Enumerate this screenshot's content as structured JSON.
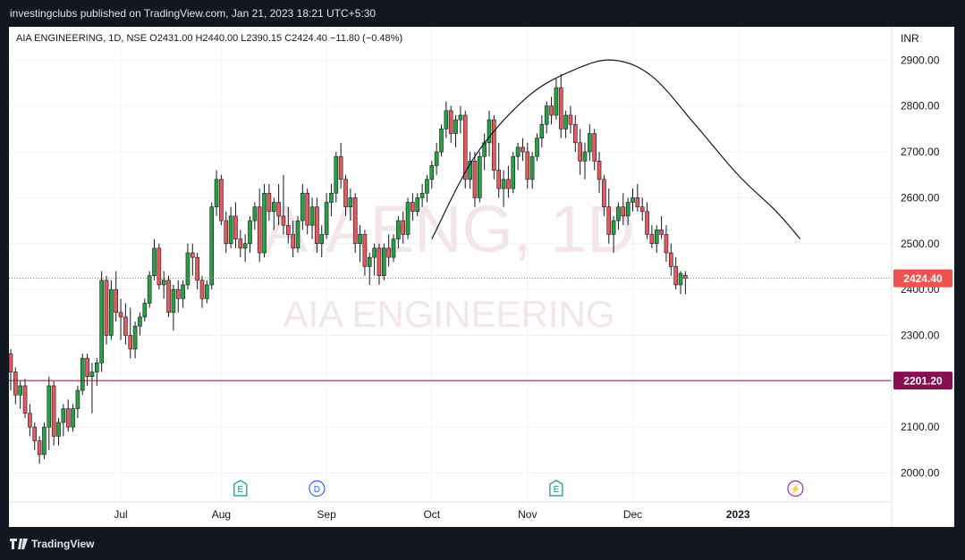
{
  "header": {
    "publish_text": "investingclubs published on TradingView.com, Jan 21, 2023 18:21 UTC+5:30"
  },
  "footer": {
    "brand": "TradingView"
  },
  "legend": {
    "text": "AIA ENGINEERING, 1D, NSE  O2431.00  H2440.00  L2390.15  C2424.40  −11.80  (−0.48%)"
  },
  "watermark": {
    "symbol": "AIAENG, 1D",
    "name": "AIA ENGINEERING"
  },
  "price_axis": {
    "currency": "INR"
  },
  "colors": {
    "up": "#26a240",
    "down": "#e8595b",
    "level_line": "#880e4f",
    "last_price_badge": "#ef5350",
    "curve": "#131722"
  },
  "chart_data": {
    "type": "candlestick",
    "ylim": [
      1950,
      2950
    ],
    "yticks": [
      2000,
      2100,
      2200,
      2300,
      2400,
      2500,
      2600,
      2700,
      2800,
      2900
    ],
    "ytick_labels": [
      "2000.00",
      "2100.00",
      "2200.00",
      "2300.00",
      "2400.00",
      "2500.00",
      "2600.00",
      "2700.00",
      "2800.00",
      "2900.00"
    ],
    "xticks": [
      {
        "label": "Jul",
        "bar": 23
      },
      {
        "label": "Aug",
        "bar": 44
      },
      {
        "label": "Sep",
        "bar": 66
      },
      {
        "label": "Oct",
        "bar": 88
      },
      {
        "label": "Nov",
        "bar": 108
      },
      {
        "label": "Dec",
        "bar": 130
      },
      {
        "label": "2023",
        "bar": 152
      }
    ],
    "last_price": {
      "value": 2424.4,
      "label": "2424.40"
    },
    "horizontal_level": {
      "value": 2201.2,
      "label": "2201.20"
    },
    "events": [
      {
        "bar": 48,
        "type": "earnings",
        "label": "E"
      },
      {
        "bar": 64,
        "type": "dividend",
        "label": "D"
      },
      {
        "bar": 114,
        "type": "earnings",
        "label": "E"
      },
      {
        "bar": 164,
        "type": "split",
        "label": "⚡"
      }
    ],
    "rounded_top_curve": [
      {
        "bar": 88,
        "price": 2510
      },
      {
        "bar": 97,
        "price": 2690
      },
      {
        "bar": 108,
        "price": 2820
      },
      {
        "bar": 118,
        "price": 2880
      },
      {
        "bar": 126,
        "price": 2900
      },
      {
        "bar": 134,
        "price": 2865
      },
      {
        "bar": 143,
        "price": 2760
      },
      {
        "bar": 152,
        "price": 2650
      },
      {
        "bar": 160,
        "price": 2570
      },
      {
        "bar": 165,
        "price": 2510
      }
    ],
    "candles": [
      [
        2260,
        2270,
        2180,
        2220
      ],
      [
        2220,
        2230,
        2150,
        2170
      ],
      [
        2170,
        2200,
        2140,
        2190
      ],
      [
        2190,
        2205,
        2120,
        2130
      ],
      [
        2130,
        2150,
        2080,
        2100
      ],
      [
        2100,
        2110,
        2050,
        2070
      ],
      [
        2070,
        2080,
        2020,
        2040
      ],
      [
        2040,
        2110,
        2030,
        2100
      ],
      [
        2100,
        2210,
        2050,
        2190
      ],
      [
        2190,
        2200,
        2060,
        2080
      ],
      [
        2080,
        2120,
        2060,
        2110
      ],
      [
        2110,
        2150,
        2080,
        2140
      ],
      [
        2140,
        2160,
        2090,
        2100
      ],
      [
        2100,
        2150,
        2090,
        2140
      ],
      [
        2140,
        2190,
        2120,
        2180
      ],
      [
        2180,
        2260,
        2170,
        2250
      ],
      [
        2250,
        2260,
        2190,
        2210
      ],
      [
        2210,
        2240,
        2130,
        2220
      ],
      [
        2220,
        2250,
        2190,
        2240
      ],
      [
        2240,
        2440,
        2220,
        2420
      ],
      [
        2420,
        2430,
        2280,
        2300
      ],
      [
        2300,
        2420,
        2290,
        2400
      ],
      [
        2400,
        2440,
        2330,
        2350
      ],
      [
        2350,
        2380,
        2290,
        2340
      ],
      [
        2340,
        2370,
        2280,
        2300
      ],
      [
        2300,
        2360,
        2250,
        2270
      ],
      [
        2270,
        2330,
        2250,
        2320
      ],
      [
        2320,
        2350,
        2300,
        2340
      ],
      [
        2340,
        2380,
        2330,
        2370
      ],
      [
        2370,
        2440,
        2360,
        2430
      ],
      [
        2430,
        2510,
        2420,
        2490
      ],
      [
        2490,
        2500,
        2400,
        2410
      ],
      [
        2410,
        2440,
        2380,
        2420
      ],
      [
        2420,
        2430,
        2340,
        2350
      ],
      [
        2350,
        2410,
        2310,
        2400
      ],
      [
        2400,
        2420,
        2350,
        2380
      ],
      [
        2380,
        2420,
        2360,
        2410
      ],
      [
        2410,
        2500,
        2400,
        2480
      ],
      [
        2480,
        2500,
        2430,
        2470
      ],
      [
        2470,
        2480,
        2400,
        2420
      ],
      [
        2420,
        2430,
        2360,
        2380
      ],
      [
        2380,
        2420,
        2370,
        2410
      ],
      [
        2410,
        2590,
        2400,
        2580
      ],
      [
        2580,
        2660,
        2560,
        2640
      ],
      [
        2640,
        2650,
        2540,
        2550
      ],
      [
        2550,
        2570,
        2480,
        2500
      ],
      [
        2500,
        2580,
        2490,
        2560
      ],
      [
        2560,
        2590,
        2490,
        2510
      ],
      [
        2510,
        2530,
        2470,
        2490
      ],
      [
        2490,
        2520,
        2460,
        2500
      ],
      [
        2500,
        2560,
        2480,
        2550
      ],
      [
        2550,
        2590,
        2530,
        2580
      ],
      [
        2580,
        2620,
        2460,
        2480
      ],
      [
        2480,
        2630,
        2470,
        2610
      ],
      [
        2610,
        2630,
        2550,
        2570
      ],
      [
        2570,
        2600,
        2530,
        2590
      ],
      [
        2590,
        2630,
        2540,
        2560
      ],
      [
        2560,
        2650,
        2520,
        2540
      ],
      [
        2540,
        2580,
        2500,
        2520
      ],
      [
        2520,
        2550,
        2470,
        2490
      ],
      [
        2490,
        2560,
        2480,
        2550
      ],
      [
        2550,
        2630,
        2530,
        2610
      ],
      [
        2610,
        2620,
        2520,
        2540
      ],
      [
        2540,
        2600,
        2510,
        2580
      ],
      [
        2580,
        2600,
        2480,
        2500
      ],
      [
        2500,
        2540,
        2470,
        2520
      ],
      [
        2520,
        2610,
        2510,
        2590
      ],
      [
        2590,
        2630,
        2560,
        2610
      ],
      [
        2610,
        2700,
        2590,
        2690
      ],
      [
        2690,
        2720,
        2620,
        2640
      ],
      [
        2640,
        2650,
        2560,
        2580
      ],
      [
        2580,
        2620,
        2550,
        2600
      ],
      [
        2600,
        2610,
        2480,
        2500
      ],
      [
        2500,
        2540,
        2460,
        2520
      ],
      [
        2520,
        2530,
        2430,
        2450
      ],
      [
        2450,
        2480,
        2410,
        2470
      ],
      [
        2470,
        2500,
        2430,
        2490
      ],
      [
        2490,
        2500,
        2410,
        2430
      ],
      [
        2430,
        2500,
        2420,
        2490
      ],
      [
        2490,
        2520,
        2450,
        2470
      ],
      [
        2470,
        2520,
        2460,
        2510
      ],
      [
        2510,
        2560,
        2490,
        2550
      ],
      [
        2550,
        2570,
        2500,
        2520
      ],
      [
        2520,
        2600,
        2510,
        2590
      ],
      [
        2590,
        2610,
        2550,
        2570
      ],
      [
        2570,
        2610,
        2560,
        2600
      ],
      [
        2600,
        2630,
        2580,
        2610
      ],
      [
        2610,
        2650,
        2590,
        2640
      ],
      [
        2640,
        2680,
        2620,
        2670
      ],
      [
        2670,
        2720,
        2650,
        2700
      ],
      [
        2700,
        2760,
        2690,
        2750
      ],
      [
        2750,
        2810,
        2730,
        2790
      ],
      [
        2790,
        2800,
        2720,
        2740
      ],
      [
        2740,
        2780,
        2710,
        2770
      ],
      [
        2770,
        2800,
        2740,
        2780
      ],
      [
        2780,
        2790,
        2620,
        2640
      ],
      [
        2640,
        2700,
        2620,
        2680
      ],
      [
        2680,
        2700,
        2580,
        2600
      ],
      [
        2600,
        2700,
        2590,
        2690
      ],
      [
        2690,
        2740,
        2660,
        2720
      ],
      [
        2720,
        2790,
        2690,
        2770
      ],
      [
        2770,
        2780,
        2640,
        2660
      ],
      [
        2660,
        2720,
        2600,
        2620
      ],
      [
        2620,
        2660,
        2580,
        2640
      ],
      [
        2640,
        2670,
        2600,
        2620
      ],
      [
        2620,
        2700,
        2610,
        2690
      ],
      [
        2690,
        2720,
        2660,
        2710
      ],
      [
        2710,
        2730,
        2680,
        2700
      ],
      [
        2700,
        2720,
        2620,
        2640
      ],
      [
        2640,
        2700,
        2620,
        2690
      ],
      [
        2690,
        2740,
        2680,
        2730
      ],
      [
        2730,
        2780,
        2710,
        2760
      ],
      [
        2760,
        2810,
        2740,
        2800
      ],
      [
        2800,
        2820,
        2760,
        2780
      ],
      [
        2780,
        2860,
        2770,
        2840
      ],
      [
        2840,
        2870,
        2730,
        2750
      ],
      [
        2750,
        2790,
        2730,
        2780
      ],
      [
        2780,
        2800,
        2740,
        2760
      ],
      [
        2760,
        2780,
        2700,
        2720
      ],
      [
        2720,
        2750,
        2650,
        2680
      ],
      [
        2680,
        2720,
        2640,
        2700
      ],
      [
        2700,
        2760,
        2680,
        2740
      ],
      [
        2740,
        2750,
        2660,
        2680
      ],
      [
        2680,
        2700,
        2610,
        2640
      ],
      [
        2640,
        2650,
        2560,
        2580
      ],
      [
        2580,
        2620,
        2500,
        2520
      ],
      [
        2520,
        2560,
        2480,
        2550
      ],
      [
        2550,
        2590,
        2530,
        2580
      ],
      [
        2580,
        2610,
        2540,
        2560
      ],
      [
        2560,
        2600,
        2540,
        2590
      ],
      [
        2590,
        2620,
        2570,
        2600
      ],
      [
        2600,
        2630,
        2570,
        2580
      ],
      [
        2580,
        2600,
        2550,
        2570
      ],
      [
        2570,
        2590,
        2510,
        2520
      ],
      [
        2520,
        2540,
        2490,
        2500
      ],
      [
        2500,
        2540,
        2480,
        2530
      ],
      [
        2530,
        2560,
        2510,
        2520
      ],
      [
        2520,
        2540,
        2460,
        2480
      ],
      [
        2480,
        2500,
        2430,
        2450
      ],
      [
        2450,
        2470,
        2400,
        2410
      ],
      [
        2410,
        2440,
        2390,
        2435
      ],
      [
        2431,
        2440,
        2390,
        2424
      ]
    ]
  }
}
